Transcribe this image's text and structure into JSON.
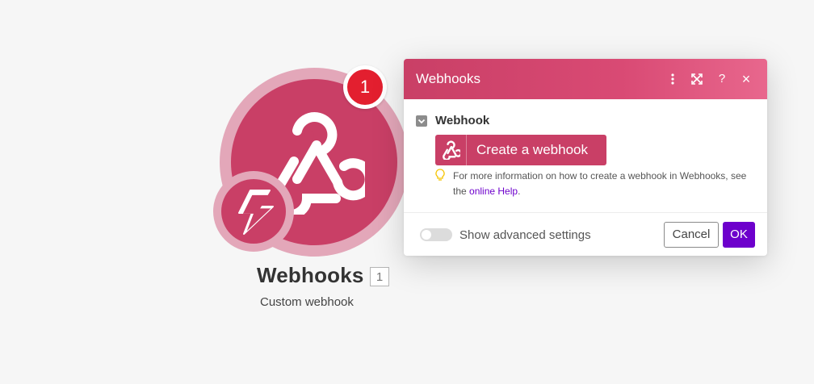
{
  "colors": {
    "module_primary": "#c93f66",
    "module_light": "#e3a7b9",
    "badge_red": "#e31f2f",
    "accent_purple": "#6d00cc"
  },
  "module": {
    "title": "Webhooks",
    "id": "1",
    "subtitle": "Custom webhook",
    "operations_badge": "1",
    "icon": "webhook-icon",
    "trigger_icon": "lightning-bolt-icon"
  },
  "dialog": {
    "title": "Webhooks",
    "header_icons": [
      "more-vertical-icon",
      "expand-icon",
      "help-icon",
      "close-icon"
    ],
    "header_help": "?",
    "header_close": "×",
    "field": {
      "label": "Webhook",
      "create_button": "Create a webhook",
      "hint_text": "For more information on how to create a webhook in Webhooks, see the ",
      "hint_link": "online Help",
      "hint_end": "."
    },
    "footer": {
      "advanced_label": "Show advanced settings",
      "advanced_enabled": false,
      "cancel": "Cancel",
      "ok": "OK"
    }
  }
}
